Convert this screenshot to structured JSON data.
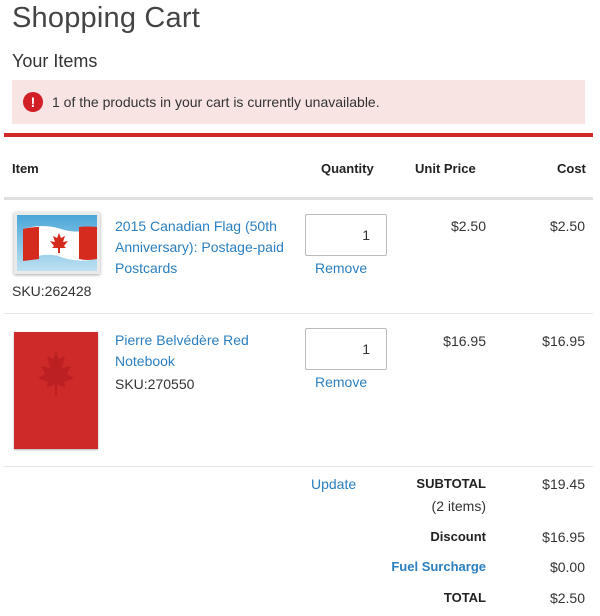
{
  "page_title": "Shopping Cart",
  "section_title": "Your Items",
  "alert": {
    "icon": "exclamation-icon",
    "icon_glyph": "!",
    "message": "1 of the products in your cart is currently unavailable.",
    "color": "#d21f26",
    "background": "#f8e4e3"
  },
  "table": {
    "headers": {
      "item": "Item",
      "quantity": "Quantity",
      "unit_price": "Unit Price",
      "cost": "Cost"
    }
  },
  "items": [
    {
      "image": "canadian-flag-postcard-image",
      "name_lines": [
        "2015 Canadian Flag (50th",
        "Anniversary): Postage-paid",
        "Postcards"
      ],
      "sku": "SKU:262428",
      "quantity": "1",
      "remove_label": "Remove",
      "unit_price": "$2.50",
      "cost": "$2.50"
    },
    {
      "image": "red-notebook-image",
      "name_lines": [
        "Pierre Belvédère Red",
        "Notebook"
      ],
      "sku": "SKU:270550",
      "quantity": "1",
      "remove_label": "Remove",
      "unit_price": "$16.95",
      "cost": "$16.95"
    }
  ],
  "update_label": "Update",
  "summary": {
    "subtotal_label": "SUBTOTAL",
    "subtotal_count": "(2 items)",
    "subtotal_value": "$19.45",
    "discount_label": "Discount",
    "discount_value": "$16.95",
    "fuel_label": "Fuel Surcharge",
    "fuel_value": "$0.00",
    "total_label": "TOTAL",
    "total_value": "$2.50"
  },
  "colors": {
    "accent_red": "#cf2a27",
    "link_blue": "#2b7fc0"
  }
}
